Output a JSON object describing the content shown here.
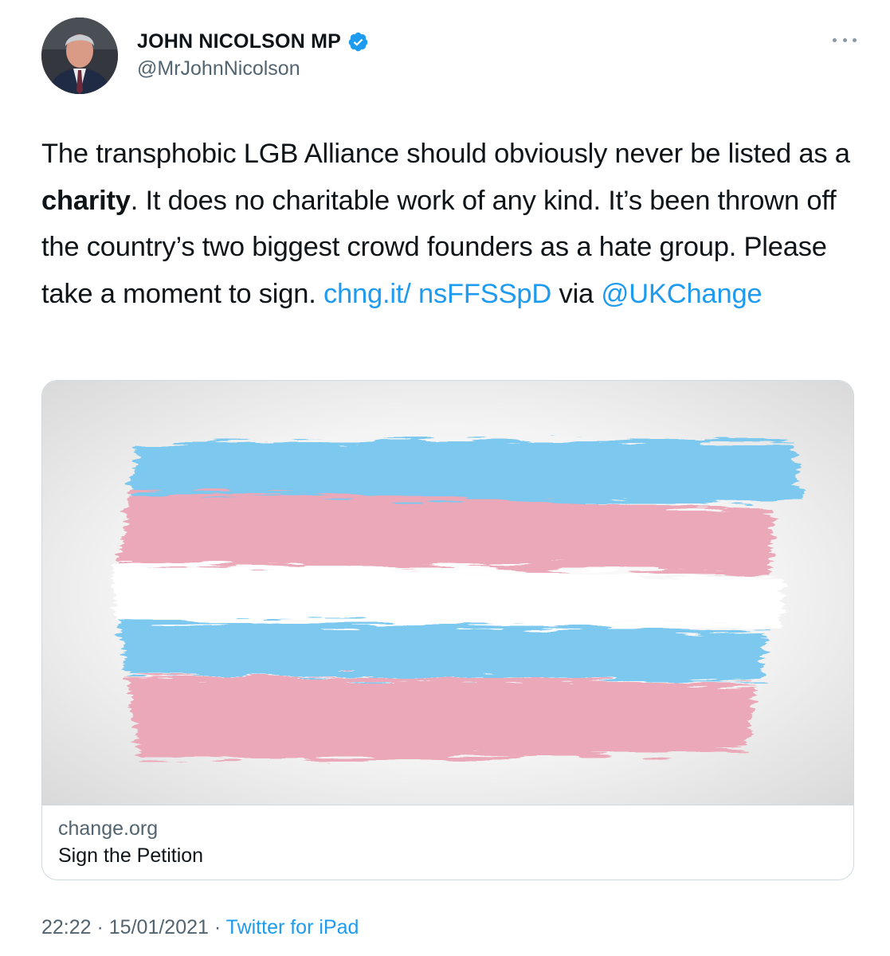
{
  "author": {
    "display_name": "JOHN NICOLSON MP",
    "handle": "@MrJohnNicolson",
    "verified": true,
    "avatar_icon": "avatar-photo"
  },
  "tweet": {
    "text_segments": {
      "s1": "The transphobic LGB Alliance should obviously never be listed as a ",
      "s2_bold": "charity",
      "s3": ". It does no charitable work of any kind. It’s been thrown off the country’s two biggest crowd founders as a hate group. Please take a moment to sign. ",
      "link": "chng.it/ nsFFSSpD",
      "s4": " via ",
      "mention": "@UKChange"
    }
  },
  "card": {
    "domain": "change.org",
    "title": "Sign the Petition",
    "image_icon": "brush-stroke-flag-image",
    "colors": {
      "blue": "#7cc8ee",
      "pink": "#eba8b8",
      "white": "#ffffff"
    }
  },
  "meta": {
    "time": "22:22",
    "separator": " · ",
    "date": "15/01/2021",
    "source": "Twitter for iPad"
  },
  "colors": {
    "link": "#1d9bf0",
    "secondary_text": "#536471",
    "primary_text": "#0f1419",
    "border": "#cfd9de"
  }
}
